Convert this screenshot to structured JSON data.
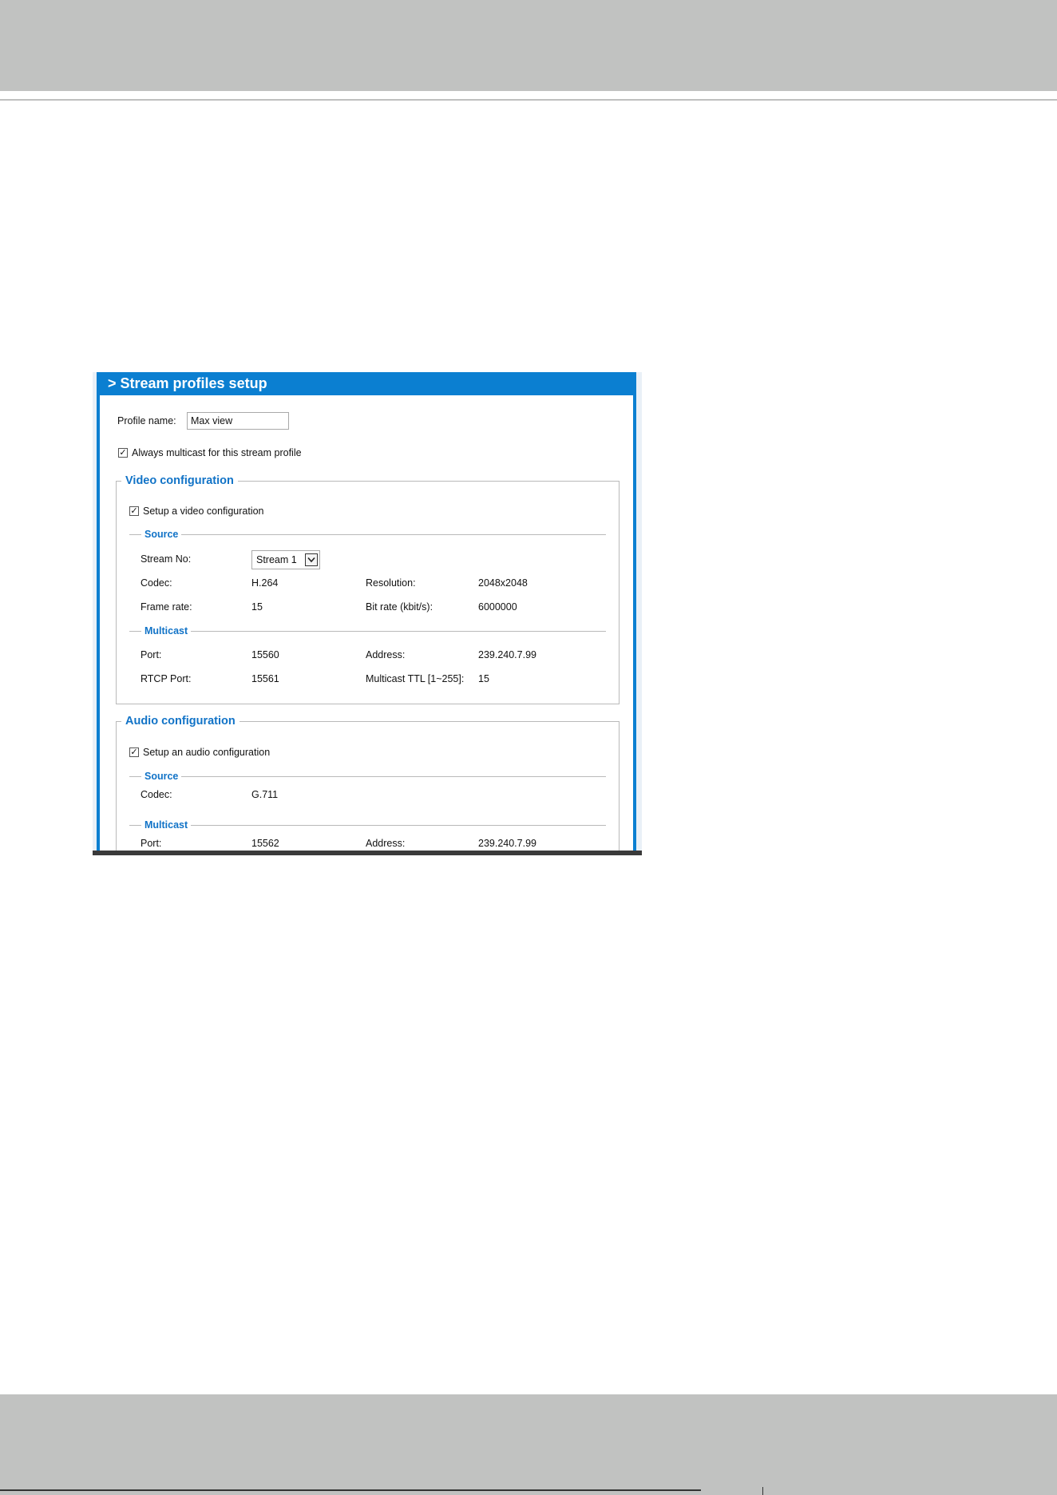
{
  "panel": {
    "title": "> Stream profiles setup",
    "profile_name": {
      "label": "Profile name:",
      "value": "Max view"
    },
    "always_multicast": {
      "label": "Always multicast for this stream profile",
      "checked": true
    }
  },
  "video": {
    "legend": "Video configuration",
    "setup": {
      "label": "Setup a video configuration",
      "checked": true
    },
    "source": {
      "legend": "Source",
      "stream_no_label": "Stream No:",
      "stream_no_value": "Stream 1",
      "codec_label": "Codec:",
      "codec_value": "H.264",
      "resolution_label": "Resolution:",
      "resolution_value": "2048x2048",
      "frame_rate_label": "Frame rate:",
      "frame_rate_value": "15",
      "bit_rate_label": "Bit rate (kbit/s):",
      "bit_rate_value": "6000000"
    },
    "multicast": {
      "legend": "Multicast",
      "port_label": "Port:",
      "port_value": "15560",
      "address_label": "Address:",
      "address_value": "239.240.7.99",
      "rtcp_port_label": "RTCP Port:",
      "rtcp_port_value": "15561",
      "ttl_label": "Multicast TTL [1~255]:",
      "ttl_value": "15"
    }
  },
  "audio": {
    "legend": "Audio configuration",
    "setup": {
      "label": "Setup an audio configuration",
      "checked": true
    },
    "source": {
      "legend": "Source",
      "codec_label": "Codec:",
      "codec_value": "G.711"
    },
    "multicast": {
      "legend": "Multicast",
      "port_label": "Port:",
      "port_value": "15562",
      "address_label": "Address:",
      "address_value": "239.240.7.99"
    }
  },
  "icons": {
    "checkmark": "checkmark-icon",
    "dropdown": "chevron-down-icon"
  },
  "colors": {
    "accent": "#0b7fd1",
    "legend_text": "#1173c7",
    "page_band": "#c1c2c1"
  }
}
